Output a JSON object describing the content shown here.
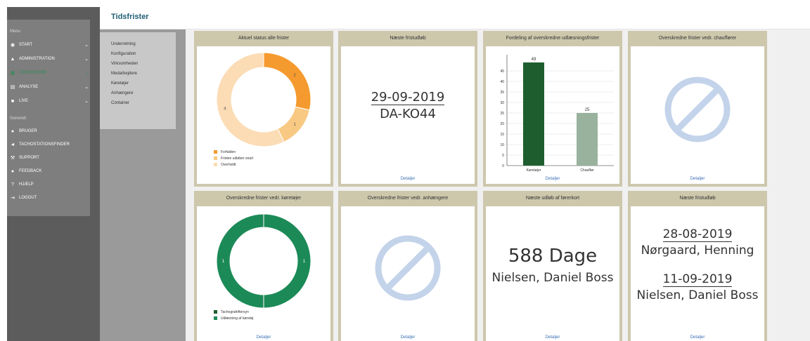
{
  "colors": {
    "orange": "#f59a2e",
    "light_orange": "#f8c982",
    "peach": "#fbdcb5",
    "dark_green": "#1e5e2e",
    "gray_green": "#98b29d",
    "green": "#1c8a57",
    "no_entry": "#c3d3ea",
    "link": "#3a6fb5"
  },
  "sidebar": {
    "menu_header": "Menu",
    "items": [
      {
        "label": "START",
        "icon": "gauge-icon"
      },
      {
        "label": "ADMINISTRATION",
        "icon": "bank-icon"
      },
      {
        "label": "TIDSFRISTER",
        "icon": "calendar-icon"
      },
      {
        "label": "ANALYSE",
        "icon": "chart-icon"
      },
      {
        "label": "LIVE",
        "icon": "truck-icon"
      }
    ],
    "general_header": "Generelt",
    "general_items": [
      {
        "label": "BRUGER",
        "icon": "user-icon"
      },
      {
        "label": "TACHOSTATIONSFINDER",
        "icon": "location-arrow-icon"
      },
      {
        "label": "SUPPORT",
        "icon": "wrench-icon"
      },
      {
        "label": "FEEDBACK",
        "icon": "comment-icon"
      },
      {
        "label": "HJÆLP",
        "icon": "question-icon"
      },
      {
        "label": "LOGOUT",
        "icon": "logout-icon"
      }
    ]
  },
  "subnav": {
    "items": [
      "Underretning",
      "Konfiguration",
      "Virksomheden",
      "Medarbejdere",
      "Køretøjer",
      "Anhængere",
      "Container"
    ]
  },
  "header": {
    "title": "Tidsfrister"
  },
  "cards": {
    "status": {
      "title": "Aktuel status alle frister",
      "legend": [
        "Forfalden",
        "Fristen udløber snart",
        "Overholdt"
      ],
      "detail": ""
    },
    "next_deadline": {
      "title": "Næste fristudløb",
      "date": "29-09-2019",
      "name": "DA-KO44",
      "detail": "Detaljer"
    },
    "distribution": {
      "title": "Fordeling af overskredne udlæsningsfrister",
      "detail": "Detaljer"
    },
    "drivers": {
      "title": "Overskredne frister vedr. chauffører",
      "detail": "Detaljer"
    },
    "vehicles": {
      "title": "Overskredne frister vedr. køretøjer",
      "legend": [
        "Tachografeftersyn",
        "Udlæsning af køretøj"
      ],
      "detail": "Detaljer"
    },
    "trailers": {
      "title": "Overskredne frister vedr. anhængere",
      "detail": "Detaljer"
    },
    "license": {
      "title": "Næste udløb af førerkort",
      "days": "588 Dage",
      "name": "Nielsen, Daniel Boss",
      "detail": "Detaljer"
    },
    "next_deadline2": {
      "title": "Næste fristudløb",
      "date1": "28-08-2019",
      "name1": "Nørgaard, Henning",
      "date2": "11-09-2019",
      "name2": "Nielsen, Daniel Boss",
      "detail": "Detaljer"
    }
  },
  "chart_data": [
    {
      "type": "pie",
      "title": "Aktuel status alle frister",
      "categories": [
        "Forfalden",
        "Fristen udløber snart",
        "Overholdt"
      ],
      "values": [
        2,
        1,
        4
      ],
      "data_labels": [
        "2",
        "1",
        "4"
      ]
    },
    {
      "type": "bar",
      "title": "Fordeling af overskredne udlæsningsfrister",
      "categories": [
        "Køretøjer",
        "Chauffør"
      ],
      "values": [
        49,
        25
      ],
      "data_labels": [
        "49",
        "25"
      ],
      "ylim": [
        0,
        50
      ],
      "yticks": [
        "0",
        "5",
        "10",
        "15",
        "20",
        "25",
        "30",
        "35",
        "40",
        "45"
      ],
      "grid": true
    },
    {
      "type": "pie",
      "title": "Overskredne frister vedr. køretøjer",
      "categories": [
        "Tachografeftersyn",
        "Udlæsning af køretøj"
      ],
      "values": [
        1,
        1
      ],
      "data_labels": [
        "1",
        "1"
      ]
    }
  ]
}
